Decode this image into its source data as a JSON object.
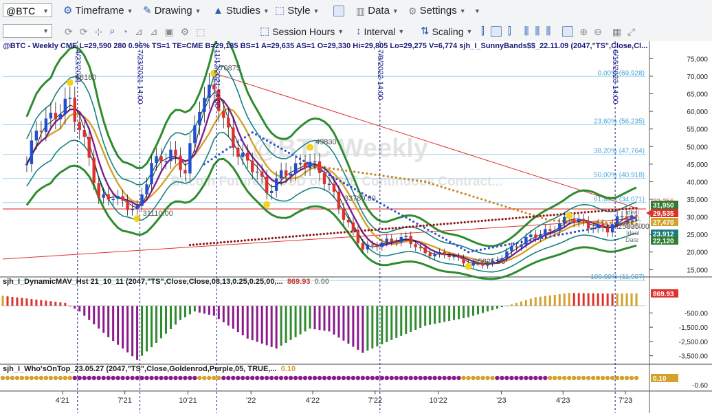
{
  "toolbar": {
    "symbol": "@BTC",
    "timeframe": "Timeframe",
    "drawing": "Drawing",
    "studies": "Studies",
    "style": "Style",
    "data": "Data",
    "settings": "Settings",
    "session_hours": "Session Hours",
    "interval": "Interval",
    "scaling": "Scaling"
  },
  "chart_data": [
    {
      "type": "candlestick",
      "header": "@BTC - Weekly  CME  L=29,590  280  0.96%  TS=1  TE=CME  B=29,185  BS=1  A=29,635  AS=1  O=29,330  Hi=29,805  Lo=29,275  V=6,774  sjh_I_SunnyBands$$_22.11.09 (2047,\"TS\",Close,Cl...",
      "watermark": [
        "@BTC Weekly",
        "Bitcoin Futures - USD on CME Continuous Contract..."
      ],
      "ylim": [
        13500,
        78000
      ],
      "yticks": [
        15000,
        20000,
        25000,
        30000,
        35000,
        40000,
        45000,
        50000,
        55000,
        60000,
        65000,
        70000,
        75000
      ],
      "yticklabels": [
        "15,000",
        "20,000",
        "25,000",
        "30,000",
        "35,000",
        "40,000",
        "45,000",
        "50,000",
        "55,000",
        "60,000",
        "65,000",
        "70,000",
        "75,000"
      ],
      "close_path": [
        [
          "2021-02-08",
          45000
        ],
        [
          "2021-02-22",
          55000
        ],
        [
          "2021-03-15",
          58000
        ],
        [
          "2021-04-12",
          63000
        ],
        [
          "2021-04-26",
          55000
        ],
        [
          "2021-05-10",
          47000
        ],
        [
          "2021-05-24",
          35000
        ],
        [
          "2021-06-14",
          36000
        ],
        [
          "2021-07-05",
          33000
        ],
        [
          "2021-07-19",
          32000
        ],
        [
          "2021-08-09",
          45000
        ],
        [
          "2021-09-06",
          48000
        ],
        [
          "2021-09-27",
          43000
        ],
        [
          "2021-10-18",
          62000
        ],
        [
          "2021-11-08",
          67000
        ],
        [
          "2021-11-22",
          57000
        ],
        [
          "2021-12-13",
          48000
        ],
        [
          "2022-01-10",
          43000
        ],
        [
          "2022-01-24",
          37000
        ],
        [
          "2022-02-14",
          42000
        ],
        [
          "2022-03-28",
          46000
        ],
        [
          "2022-04-25",
          39000
        ],
        [
          "2022-05-16",
          30000
        ],
        [
          "2022-06-13",
          21000
        ],
        [
          "2022-07-18",
          23000
        ],
        [
          "2022-08-15",
          24000
        ],
        [
          "2022-09-12",
          19500
        ],
        [
          "2022-10-17",
          19200
        ],
        [
          "2022-11-14",
          16500
        ],
        [
          "2022-12-19",
          16800
        ],
        [
          "2023-01-16",
          21000
        ],
        [
          "2023-02-13",
          24500
        ],
        [
          "2023-03-13",
          26000
        ],
        [
          "2023-04-10",
          30000
        ],
        [
          "2023-05-08",
          27500
        ],
        [
          "2023-06-05",
          26500
        ],
        [
          "2023-06-26",
          30500
        ],
        [
          "2023-07-17",
          29535
        ]
      ],
      "xticks": [
        "2021-04-01",
        "2021-07-01",
        "2021-10-01",
        "2022-01-01",
        "2022-04-01",
        "2022-07-01",
        "2022-10-01",
        "2023-01-01",
        "2023-04-01",
        "2023-07-01"
      ],
      "xticklabels": [
        "4'21",
        "7'21",
        "10'21",
        "'22",
        "4'22",
        "7'22",
        "10'22",
        "'23",
        "4'23",
        "7'23"
      ],
      "fibonacci": [
        {
          "label": "0.00% (69,928)",
          "value": 69928
        },
        {
          "label": "23.60% (56,235)",
          "value": 56235
        },
        {
          "label": "38.20% (47,764)",
          "value": 47764
        },
        {
          "label": "50.00% (40,918)",
          "value": 40918
        },
        {
          "label": "61.80% (34,071)",
          "value": 34071
        },
        {
          "label": "100.00% (11,907)",
          "value": 11907
        }
      ],
      "pivot_labels": [
        {
          "text": "68180",
          "date": "2021-04-12",
          "value": 68180
        },
        {
          "text": "70875",
          "date": "2021-11-08",
          "value": 70875
        },
        {
          "text": "31110.00",
          "date": "2021-07-19",
          "value": 29500
        },
        {
          "text": "49830",
          "date": "2022-03-28",
          "value": 49830
        },
        {
          "text": "33780.00",
          "date": "2022-05-09",
          "value": 33780
        },
        {
          "text": "15825.00",
          "date": "2022-11-14",
          "value": 15825
        },
        {
          "text": "25835.00",
          "date": "2023-06-12",
          "value": 25835
        }
      ],
      "vlines": [
        {
          "label": "4/23/2021",
          "date": "2021-04-23"
        },
        {
          "label": "7/23/2021 14:00",
          "date": "2021-07-23"
        },
        {
          "label": "11/12/2021 14:00",
          "date": "2021-11-12"
        },
        {
          "label": "7/8/2022 14:00",
          "date": "2022-07-08"
        },
        {
          "label": "6/16/2023 14:00",
          "date": "2023-06-16"
        }
      ],
      "support_level": 32256,
      "trendline_down": [
        [
          "2021-11-08",
          70875
        ],
        [
          "2023-07-17",
          32500
        ]
      ],
      "trendline_up": [
        [
          "2021-01-04",
          18000
        ],
        [
          "2023-07-17",
          29500
        ]
      ],
      "right_labels": [
        {
          "text": "32,256",
          "value": 32256,
          "color": "#e0302a",
          "filled": false
        },
        {
          "text": "31,950",
          "value": 31950,
          "color": "#2e7d32",
          "filled": true
        },
        {
          "text": "29,535",
          "value": 29535,
          "color": "#e0302a",
          "filled": true
        },
        {
          "text": "27,470",
          "value": 27470,
          "color": "#d4a12a",
          "filled": true
        },
        {
          "text": "23,912",
          "value": 23912,
          "color": "#1a7c7c",
          "filled": true
        },
        {
          "text": "22,120",
          "value": 22120,
          "color": "#2e7d32",
          "filled": true
        }
      ],
      "tags": [
        "Ideal",
        "BULL",
        "GOLD",
        "Ideal",
        "Date"
      ]
    },
    {
      "type": "bar",
      "header": "sjh_I_DynamicMAV_Hst 21_10_11 (2047,\"TS\",Close,Close,08,13,0.25,0.25,00,...",
      "value_label": "869.93",
      "zero_label": "0.00",
      "ylim": [
        -4000,
        1300
      ],
      "yticks": [
        -500,
        -1500,
        -2500,
        -3500
      ],
      "yticklabels": [
        "-500.00",
        "-1,500.00",
        "-2,500.00",
        "-3,500.00"
      ],
      "last_value_label": "869.93",
      "profile": [
        [
          "2021-01-04",
          700
        ],
        [
          "2021-03-01",
          400
        ],
        [
          "2021-04-05",
          200
        ],
        [
          "2021-04-26",
          -400
        ],
        [
          "2021-06-07",
          -2200
        ],
        [
          "2021-07-19",
          -3800
        ],
        [
          "2021-08-16",
          -2600
        ],
        [
          "2021-09-20",
          -1000
        ],
        [
          "2021-10-11",
          -400
        ],
        [
          "2021-11-08",
          -700
        ],
        [
          "2021-12-27",
          -2300
        ],
        [
          "2022-02-07",
          -3000
        ],
        [
          "2022-03-28",
          -1600
        ],
        [
          "2022-04-25",
          -1800
        ],
        [
          "2022-06-13",
          -3300
        ],
        [
          "2022-07-25",
          -2400
        ],
        [
          "2022-09-12",
          -1400
        ],
        [
          "2022-11-14",
          -800
        ],
        [
          "2022-12-26",
          -200
        ],
        [
          "2023-01-23",
          200
        ],
        [
          "2023-02-20",
          600
        ],
        [
          "2023-04-10",
          900
        ],
        [
          "2023-06-12",
          850
        ],
        [
          "2023-07-17",
          870
        ]
      ]
    },
    {
      "type": "dots",
      "header": "sjh_I_Who'sOnTop_23.05.27 (2047,\"TS\",Close,Goldenrod,Purple,05,  TRUE,...",
      "value_label": "0.10",
      "yticklabels": [
        "0.10",
        "-0.60"
      ],
      "segments": [
        [
          "2021-01-04",
          "2021-04-12",
          "#d4a12a"
        ],
        [
          "2021-04-19",
          "2021-10-11",
          "#8b1a8b"
        ],
        [
          "2021-10-18",
          "2021-11-15",
          "#d4a12a"
        ],
        [
          "2021-11-22",
          "2022-10-31",
          "#8b1a8b"
        ],
        [
          "2022-11-07",
          "2022-12-19",
          "#d4a12a"
        ],
        [
          "2022-12-26",
          "2023-03-06",
          "#8b1a8b"
        ],
        [
          "2023-03-13",
          "2023-07-17",
          "#d4a12a"
        ]
      ]
    }
  ]
}
